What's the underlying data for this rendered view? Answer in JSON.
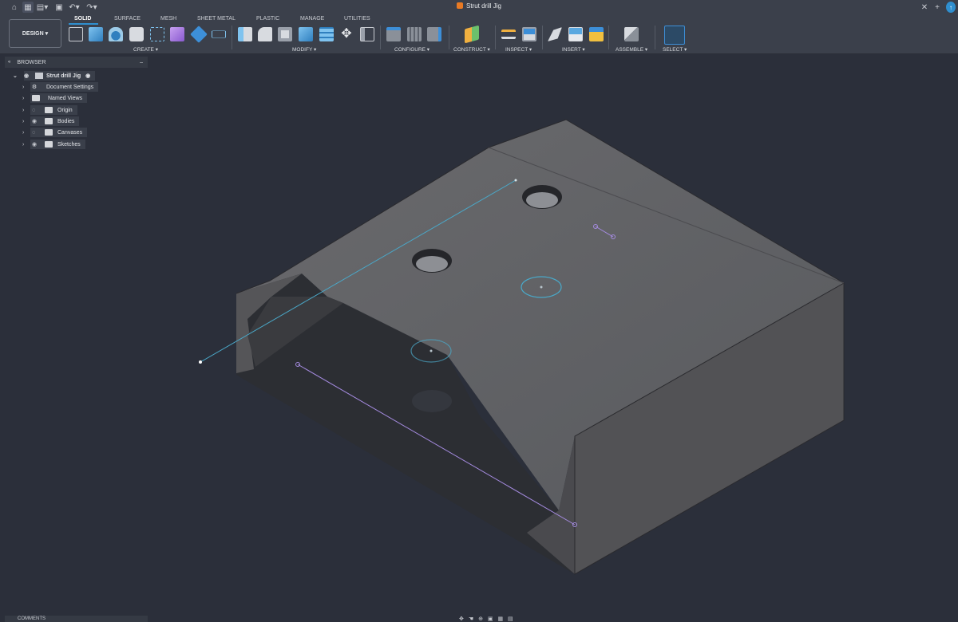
{
  "titlebar": {
    "document_title": "Strut drill Jig"
  },
  "toolbar": {
    "workspace_button": "DESIGN",
    "tabs": [
      "SOLID",
      "SURFACE",
      "MESH",
      "SHEET METAL",
      "PLASTIC",
      "MANAGE",
      "UTILITIES"
    ],
    "groups": [
      "CREATE",
      "MODIFY",
      "CONFIGURE",
      "CONSTRUCT",
      "INSPECT",
      "INSERT",
      "ASSEMBLE",
      "SELECT"
    ]
  },
  "browser": {
    "header": "BROWSER",
    "root": "Strut drill Jig",
    "items": [
      "Document Settings",
      "Named Views",
      "Origin",
      "Bodies",
      "Canvases",
      "Sketches"
    ]
  },
  "comments": {
    "label": "COMMENTS"
  },
  "colors": {
    "accent": "#2f8fcf",
    "model_top": "#5d5d60",
    "model_front": "#525255",
    "sketch_purple": "#a58be0",
    "sketch_cyan": "#4aa8c8"
  }
}
